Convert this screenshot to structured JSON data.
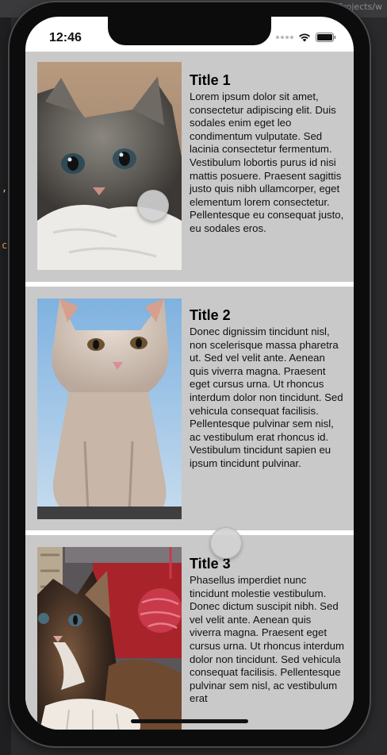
{
  "ide": {
    "path_text": "wbma / ~/Documents/stProjects/w",
    "gutter_glyph_1": ",",
    "gutter_glyph_2": "c"
  },
  "status_bar": {
    "time": "12:46",
    "icons": [
      "signal-dots-icon",
      "wifi-icon",
      "battery-icon"
    ]
  },
  "cells": [
    {
      "title": "Title 1",
      "image": "tabby-kitten-on-white-blanket",
      "body": "Lorem ipsum dolor sit amet, consectetur adipiscing elit. Duis sodales enim eget leo condimentum vulputate. Sed lacinia consectetur fermentum. Vestibulum lobortis purus id nisi mattis posuere. Praesent sagittis justo quis nibh ullamcorper, eget elementum lorem consectetur. Pellentesque eu consequat justo, eu sodales eros."
    },
    {
      "title": "Title 2",
      "image": "cream-kitten-sitting-sky-background",
      "body": "Donec dignissim tincidunt nisl, non scelerisque massa pharetra ut. Sed vel velit ante. Aenean quis viverra magna. Praesent eget cursus urna. Ut rhoncus interdum dolor non tincidunt. Sed vehicula consequat facilisis. Pellentesque pulvinar sem nisl, ac vestibulum erat rhoncus id. Vestibulum tincidunt sapien eu ipsum tincidunt pulvinar."
    },
    {
      "title": "Title 3",
      "image": "calico-kitten-with-yarn-ball",
      "body": "Phasellus imperdiet nunc tincidunt molestie vestibulum. Donec dictum suscipit nibh. Sed vel velit ante. Aenean quis viverra magna. Praesent eget cursus urna. Ut rhoncus interdum dolor non tincidunt. Sed vehicula consequat facilisis. Pellentesque pulvinar sem nisl, ac vestibulum erat"
    }
  ],
  "colors": {
    "cell_background": "#c9c9c9",
    "separator": "#ffffff",
    "text": "#000000"
  }
}
